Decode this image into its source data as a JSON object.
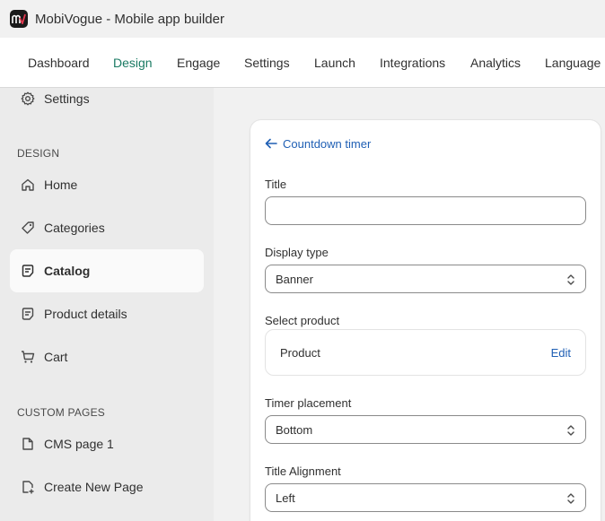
{
  "app": {
    "title": "MobiVogue - Mobile app builder"
  },
  "nav": {
    "tabs": [
      {
        "label": "Dashboard"
      },
      {
        "label": "Design"
      },
      {
        "label": "Engage"
      },
      {
        "label": "Settings"
      },
      {
        "label": "Launch"
      },
      {
        "label": "Integrations"
      },
      {
        "label": "Analytics"
      },
      {
        "label": "Language"
      }
    ],
    "active_tab": "Design"
  },
  "sidebar": {
    "top_item": {
      "label": "Settings",
      "icon": "gear-icon"
    },
    "design_heading": "DESIGN",
    "design_items": [
      {
        "label": "Home",
        "icon": "home-icon"
      },
      {
        "label": "Categories",
        "icon": "tag-icon"
      },
      {
        "label": "Catalog",
        "icon": "catalog-icon",
        "active": true
      },
      {
        "label": "Product details",
        "icon": "product-details-icon"
      },
      {
        "label": "Cart",
        "icon": "cart-icon"
      }
    ],
    "custom_heading": "CUSTOM PAGES",
    "custom_items": [
      {
        "label": "CMS page 1",
        "icon": "page-icon"
      },
      {
        "label": "Create New Page",
        "icon": "page-add-icon"
      }
    ]
  },
  "panel": {
    "back_label": "Countdown timer",
    "title_label": "Title",
    "title_value": "",
    "display_type_label": "Display type",
    "display_type_value": "Banner",
    "select_product_label": "Select product",
    "product_label": "Product",
    "edit_label": "Edit",
    "timer_placement_label": "Timer placement",
    "timer_placement_value": "Bottom",
    "title_alignment_label": "Title Alignment",
    "title_alignment_value": "Left"
  },
  "colors": {
    "accent_green": "#1a7a63",
    "link_blue": "#1f5fb4",
    "sidebar_bg": "#ebebeb",
    "active_item_bg": "#fafafa"
  }
}
